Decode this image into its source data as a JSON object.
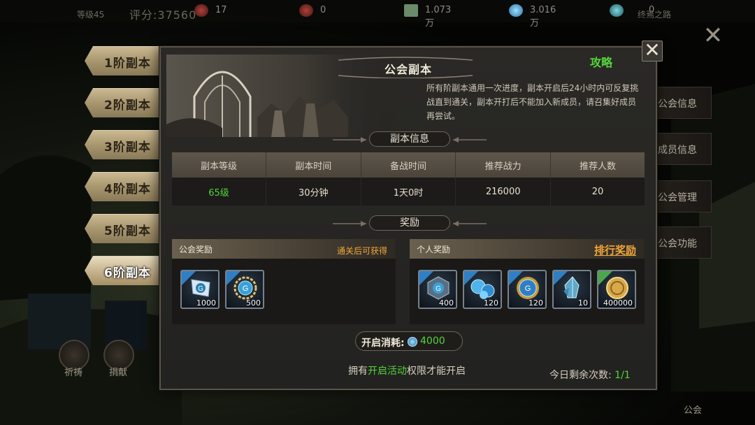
{
  "topbar": {
    "player_level": "等级45",
    "score": "评分:37560",
    "resources": [
      {
        "icon": "crown-icon",
        "value": "17"
      },
      {
        "icon": "crown-icon",
        "value": "0"
      },
      {
        "icon": "banknote-icon",
        "value": "1.073万"
      },
      {
        "icon": "guild-coin-icon",
        "value": "3.016万"
      },
      {
        "icon": "gem-icon",
        "value": "0"
      }
    ],
    "road_label": "终焉之路"
  },
  "tiers": [
    {
      "label": "1阶副本",
      "active": false
    },
    {
      "label": "2阶副本",
      "active": false
    },
    {
      "label": "3阶副本",
      "active": false
    },
    {
      "label": "4阶副本",
      "active": false
    },
    {
      "label": "5阶副本",
      "active": false
    },
    {
      "label": "6阶副本",
      "active": true
    }
  ],
  "side_menu": [
    "公会信息",
    "成员信息",
    "公会管理",
    "公会功能"
  ],
  "bottom_bar": {
    "items": [
      "祈祷",
      "捐献"
    ],
    "right_label": "公会"
  },
  "dialog": {
    "title": "公会副本",
    "strategy_link": "攻略",
    "description": "所有阶副本通用一次进度，副本开启后24小时内可反复挑战直到通关，副本开打后不能加入新成员，请召集好成员再尝试。",
    "info_section": "副本信息",
    "table": {
      "headers": [
        "副本等级",
        "副本时间",
        "备战时间",
        "推荐战力",
        "推荐人数"
      ],
      "row": [
        "65级",
        "30分钟",
        "1天0时",
        "216000",
        "20"
      ]
    },
    "reward_section": "奖励",
    "guild_reward": {
      "title": "公会奖励",
      "note": "通关后可获得",
      "items": [
        {
          "icon": "guild-flag-icon",
          "count": "1000"
        },
        {
          "icon": "guild-laurel-coin-icon",
          "count": "500"
        }
      ]
    },
    "personal_reward": {
      "title": "个人奖励",
      "rank_link": "排行奖励",
      "items": [
        {
          "icon": "guild-badge-icon",
          "count": "400"
        },
        {
          "icon": "blue-orbs-icon",
          "count": "120"
        },
        {
          "icon": "blue-medal-icon",
          "count": "120"
        },
        {
          "icon": "crystal-shard-icon",
          "count": "10"
        },
        {
          "icon": "gold-coin-icon",
          "count": "400000"
        }
      ]
    },
    "cost": {
      "label": "开启消耗:",
      "value": "4000"
    },
    "requirement": {
      "prefix": "拥有",
      "highlight": "开启活动",
      "suffix": "权限才能开启"
    },
    "remaining": {
      "label": "今日剩余次数:",
      "value": "1/1"
    }
  },
  "colors": {
    "accent_green": "#55d43c",
    "accent_orange": "#f0a63a",
    "panel": "#222220"
  }
}
